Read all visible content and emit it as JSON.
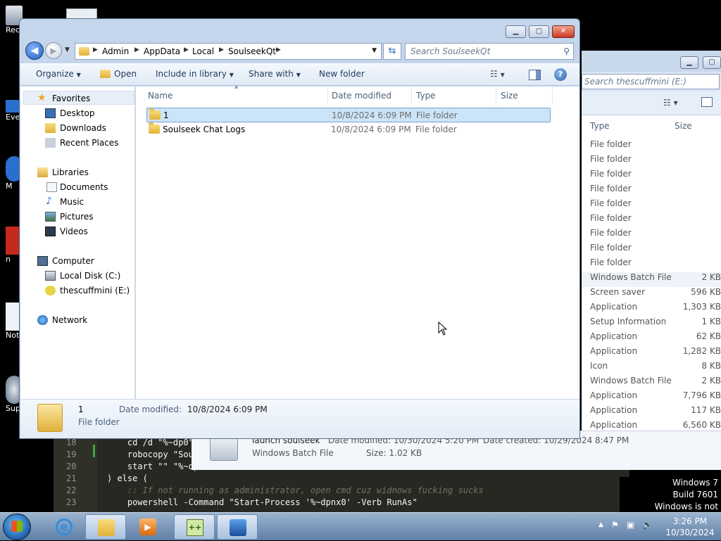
{
  "desktop": {
    "icons": [
      "Rec",
      "Eve",
      "M",
      "n",
      "Not",
      "Sup"
    ]
  },
  "editor": {
    "lines": [
      {
        "n": "18",
        "code": "    cd /d \"%~dp0\""
      },
      {
        "n": "19",
        "code": "    robocopy \"Soul"
      },
      {
        "n": "20",
        "code": "    start \"\" \"%~dp"
      },
      {
        "n": "21",
        "code": ") else ("
      },
      {
        "n": "22",
        "code": "    :: If not running as administrator, open cmd cuz widnows fucking sucks"
      },
      {
        "n": "23",
        "code": "    powershell -Command \"Start-Process '%~dpnx0' -Verb RunAs\""
      }
    ]
  },
  "background_window": {
    "search_placeholder": "Search thescuffmini (E:)",
    "col_type": "Type",
    "col_size": "Size",
    "rows": [
      {
        "type": "File folder",
        "size": ""
      },
      {
        "type": "File folder",
        "size": ""
      },
      {
        "type": "File folder",
        "size": ""
      },
      {
        "type": "File folder",
        "size": ""
      },
      {
        "type": "File folder",
        "size": ""
      },
      {
        "type": "File folder",
        "size": ""
      },
      {
        "type": "File folder",
        "size": ""
      },
      {
        "type": "File folder",
        "size": ""
      },
      {
        "type": "File folder",
        "size": ""
      },
      {
        "type": "Windows Batch File",
        "size": "2 KB"
      },
      {
        "type": "Screen saver",
        "size": "596 KB"
      },
      {
        "type": "Application",
        "size": "1,303 KB"
      },
      {
        "type": "Setup Information",
        "size": "1 KB"
      },
      {
        "type": "Application",
        "size": "62 KB"
      },
      {
        "type": "Application",
        "size": "1,282 KB"
      },
      {
        "type": "Icon",
        "size": "8 KB"
      },
      {
        "type": "Windows Batch File",
        "size": "2 KB"
      },
      {
        "type": "Application",
        "size": "7,796 KB"
      },
      {
        "type": "Application",
        "size": "117 KB"
      },
      {
        "type": "Application",
        "size": "6,560 KB"
      }
    ],
    "status": {
      "name": "launch soulseek",
      "date_modified": "Date modified: 10/30/2024 5:20 PM",
      "date_created": "Date created: 10/29/2024 8:47 PM",
      "type": "Windows Batch File",
      "size": "Size: 1.02 KB"
    }
  },
  "explorer": {
    "breadcrumbs": [
      "Admin",
      "AppData",
      "Local",
      "SoulseekQt"
    ],
    "search_placeholder": "Search SoulseekQt",
    "toolbar": {
      "organize": "Organize",
      "open": "Open",
      "include": "Include in library",
      "share": "Share with",
      "new_folder": "New folder"
    },
    "nav": {
      "favorites": "Favorites",
      "desktop": "Desktop",
      "downloads": "Downloads",
      "recent": "Recent Places",
      "libraries": "Libraries",
      "documents": "Documents",
      "music": "Music",
      "pictures": "Pictures",
      "videos": "Videos",
      "computer": "Computer",
      "local_disk": "Local Disk (C:)",
      "usb": "thescuffmini (E:)",
      "network": "Network"
    },
    "columns": {
      "name": "Name",
      "date": "Date modified",
      "type": "Type",
      "size": "Size"
    },
    "files": [
      {
        "name": "1",
        "date": "10/8/2024 6:09 PM",
        "type": "File folder",
        "size": ""
      },
      {
        "name": "Soulseek Chat Logs",
        "date": "10/8/2024 6:09 PM",
        "type": "File folder",
        "size": ""
      }
    ],
    "details": {
      "name": "1",
      "date_label": "Date modified:",
      "date_value": "10/8/2024 6:09 PM",
      "type": "File folder"
    }
  },
  "watermark": {
    "line1": "Windows 7",
    "line2": "Build 7601",
    "line3": "Windows is not genuine"
  },
  "tray": {
    "time": "3:26 PM",
    "date": "10/30/2024"
  },
  "colors": {
    "accent": "#3a7bd5",
    "selection": "#cce4f7",
    "folder": "#e8c25a"
  }
}
